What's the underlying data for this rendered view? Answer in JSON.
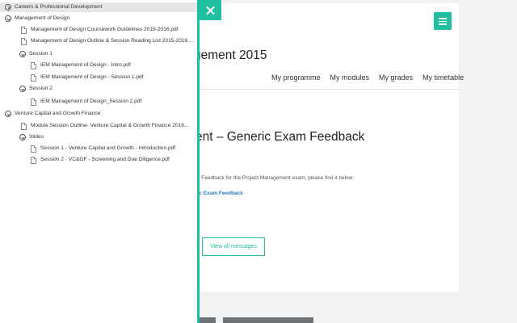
{
  "background": {
    "course_title": "gement 2015",
    "nav": [
      "My programme",
      "My modules",
      "My grades",
      "My timetable"
    ],
    "message_title": "ent – Generic Exam Feedback",
    "message_body": "m Feedback for the Project Management exam, please find it below:",
    "message_link": "ric Exam Feedback",
    "view_all_label": "View all messages"
  },
  "colors": {
    "accent": "#1fbf9f",
    "link": "#2a7ac0",
    "selected_row": "#e6e6e6"
  },
  "tree": [
    {
      "label": "Careers & Professional Development",
      "type": "folder",
      "state": "collapsed",
      "selected": true
    },
    {
      "label": "Management of Design",
      "type": "folder",
      "state": "expanded"
    },
    {
      "label": "Management of Design Coursework Guidelines 2015-2016.pdf",
      "type": "file"
    },
    {
      "label": "Management of Design Outline & Session Reading List 2015-2016....",
      "type": "file"
    },
    {
      "label": "Session 1",
      "type": "folder",
      "state": "expanded"
    },
    {
      "label": "IEM Management of Design - Intro.pdf",
      "type": "file"
    },
    {
      "label": "IEM Management of Design - Session 1.pdf",
      "type": "file"
    },
    {
      "label": "Session 2",
      "type": "folder",
      "state": "expanded"
    },
    {
      "label": "IEM Management of Design_Session 2.pdf",
      "type": "file"
    },
    {
      "label": "Venture Capital and Growth Finance",
      "type": "folder",
      "state": "expanded"
    },
    {
      "label": "Module Session Outline- Venture Capital & Growth Finance 2016...",
      "type": "file"
    },
    {
      "label": "Slides",
      "type": "folder",
      "state": "expanded"
    },
    {
      "label": "Session 1 - Venture Capital and Growth - Introduction.pdf",
      "type": "file"
    },
    {
      "label": "Session 2 - VC&GF - Screening and Due Diligence.pdf",
      "type": "file"
    }
  ]
}
